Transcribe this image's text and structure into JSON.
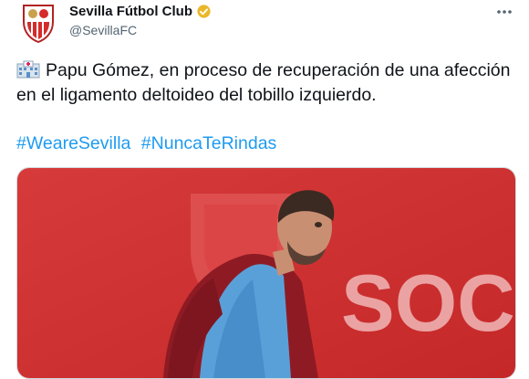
{
  "author": {
    "name": "Sevilla Fútbol Club",
    "handle": "@SevillaFC",
    "verified": true,
    "avatar_icon": "sevilla-crest-icon"
  },
  "tweet": {
    "emoji_icon": "hospital-icon",
    "text": "Papu Gómez, en proceso de recuperación de una afección en el ligamento deltoideo del tobillo izquierdo.",
    "hashtags": [
      "#WeareSevilla",
      "#NuncaTeRindas"
    ],
    "media_wall_text": "SOC"
  },
  "colors": {
    "link": "#1d9bf0",
    "verified_badge": "#e9b82a",
    "club_red": "#d52b2b"
  }
}
